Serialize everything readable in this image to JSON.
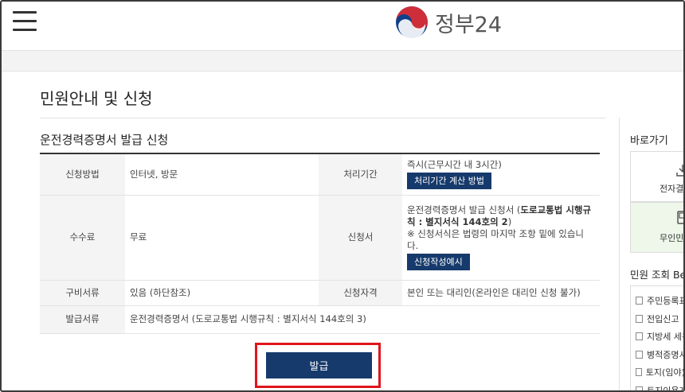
{
  "header": {
    "logo_text": "정부24",
    "menu_icon": "hamburger-menu-icon",
    "logo_icon": "government-taegeuk-logo-icon",
    "colors": {
      "logo_red": "#cd2e3a",
      "logo_blue": "#0f3f8a"
    }
  },
  "page": {
    "title": "민원안내 및 신청",
    "section_title": "운전경력증명서 발급 신청"
  },
  "table": {
    "method_label": "신청방법",
    "method_value": "인터넷, 방문",
    "period_label": "처리기간",
    "period_value": "즉시(근무시간 내 3시간)",
    "period_button": "처리기간 계산 방법",
    "fee_label": "수수료",
    "fee_value": "무료",
    "form_label": "신청서",
    "form_value_prefix": "운전경력증명서 발급 신청서 (",
    "form_value_bold": "도로교통법 시행규칙 : 별지서식 144호의 2",
    "form_value_suffix": ")",
    "form_note": "※ 신청서식은 법령의 마지막 조항 밑에 있습니다.",
    "form_button": "신청작성예시",
    "docs_label": "구비서류",
    "docs_value": "있음 (하단참조)",
    "qual_label": "신청자격",
    "qual_value": "본인 또는 대리인(온라인은 대리인 신청 불가)",
    "issue_doc_label": "발급서류",
    "issue_doc_value": "운전경력증명서 (도로교통법 시행규칙 : 별지서식 144호의 3)"
  },
  "issue_button": "발급",
  "sidebar": {
    "shortcut_title": "바로가기",
    "shortcut_items": [
      {
        "label": "전자결제",
        "icon": "download-icon"
      },
      {
        "label": "무인민원",
        "icon": "kiosk-icon"
      }
    ],
    "inquiry_title": "민원 조회 Bes",
    "inquiry_items": [
      "주민등록표",
      "전입신고",
      "지방세 세목",
      "병적증명서",
      "토지(임야)대",
      "토지이용계"
    ]
  },
  "colors": {
    "navy_button": "#163a6b",
    "highlight_border": "#e0151b"
  }
}
